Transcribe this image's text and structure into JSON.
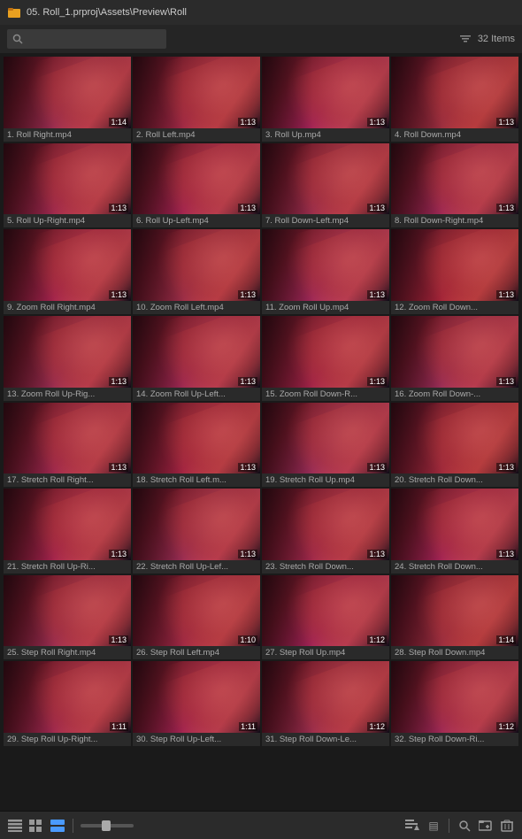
{
  "titlebar": {
    "title": "05. Roll_1.prproj\\Assets\\Preview\\Roll"
  },
  "searchbar": {
    "placeholder": "",
    "items_label": "32 Items"
  },
  "items": [
    {
      "num": "1.",
      "name": "Roll Right.mp4",
      "duration": "1:14"
    },
    {
      "num": "2.",
      "name": "Roll Left.mp4",
      "duration": "1:13"
    },
    {
      "num": "3.",
      "name": "Roll Up.mp4",
      "duration": "1:13"
    },
    {
      "num": "4.",
      "name": "Roll Down.mp4",
      "duration": "1:13"
    },
    {
      "num": "5.",
      "name": "Roll Up-Right.mp4",
      "duration": "1:13"
    },
    {
      "num": "6.",
      "name": "Roll Up-Left.mp4",
      "duration": "1:13"
    },
    {
      "num": "7.",
      "name": "Roll Down-Left.mp4",
      "duration": "1:13"
    },
    {
      "num": "8.",
      "name": "Roll Down-Right.mp4",
      "duration": "1:13"
    },
    {
      "num": "9.",
      "name": "Zoom Roll Right.mp4",
      "duration": "1:13"
    },
    {
      "num": "10.",
      "name": "Zoom Roll Left.mp4",
      "duration": "1:13"
    },
    {
      "num": "11.",
      "name": "Zoom Roll Up.mp4",
      "duration": "1:13"
    },
    {
      "num": "12.",
      "name": "Zoom Roll Down...",
      "duration": "1:13"
    },
    {
      "num": "13.",
      "name": "Zoom Roll Up-Rig...",
      "duration": "1:13"
    },
    {
      "num": "14.",
      "name": "Zoom Roll Up-Left...",
      "duration": "1:13"
    },
    {
      "num": "15.",
      "name": "Zoom Roll Down-R...",
      "duration": "1:13"
    },
    {
      "num": "16.",
      "name": "Zoom Roll Down-...",
      "duration": "1:13"
    },
    {
      "num": "17.",
      "name": "Stretch Roll Right...",
      "duration": "1:13"
    },
    {
      "num": "18.",
      "name": "Stretch Roll Left.m...",
      "duration": "1:13"
    },
    {
      "num": "19.",
      "name": "Stretch Roll Up.mp4",
      "duration": "1:13"
    },
    {
      "num": "20.",
      "name": "Stretch Roll Down...",
      "duration": "1:13"
    },
    {
      "num": "21.",
      "name": "Stretch Roll Up-Ri...",
      "duration": "1:13"
    },
    {
      "num": "22.",
      "name": "Stretch Roll Up-Lef...",
      "duration": "1:13"
    },
    {
      "num": "23.",
      "name": "Stretch Roll Down...",
      "duration": "1:13"
    },
    {
      "num": "24.",
      "name": "Stretch Roll Down...",
      "duration": "1:13"
    },
    {
      "num": "25.",
      "name": "Step Roll Right.mp4",
      "duration": "1:13"
    },
    {
      "num": "26.",
      "name": "Step Roll Left.mp4",
      "duration": "1:10"
    },
    {
      "num": "27.",
      "name": "Step Roll Up.mp4",
      "duration": "1:12"
    },
    {
      "num": "28.",
      "name": "Step Roll Down.mp4",
      "duration": "1:14"
    },
    {
      "num": "29.",
      "name": "Step Roll Up-Right...",
      "duration": "1:11"
    },
    {
      "num": "30.",
      "name": "Step Roll Up-Left...",
      "duration": "1:11"
    },
    {
      "num": "31.",
      "name": "Step Roll Down-Le...",
      "duration": "1:12"
    },
    {
      "num": "32.",
      "name": "Step Roll Down-Ri...",
      "duration": "1:12"
    }
  ],
  "toolbar": {
    "list_icon": "☰",
    "grid_icon": "⊞",
    "freeform_icon": "⊟",
    "zoom_label": "zoom"
  }
}
